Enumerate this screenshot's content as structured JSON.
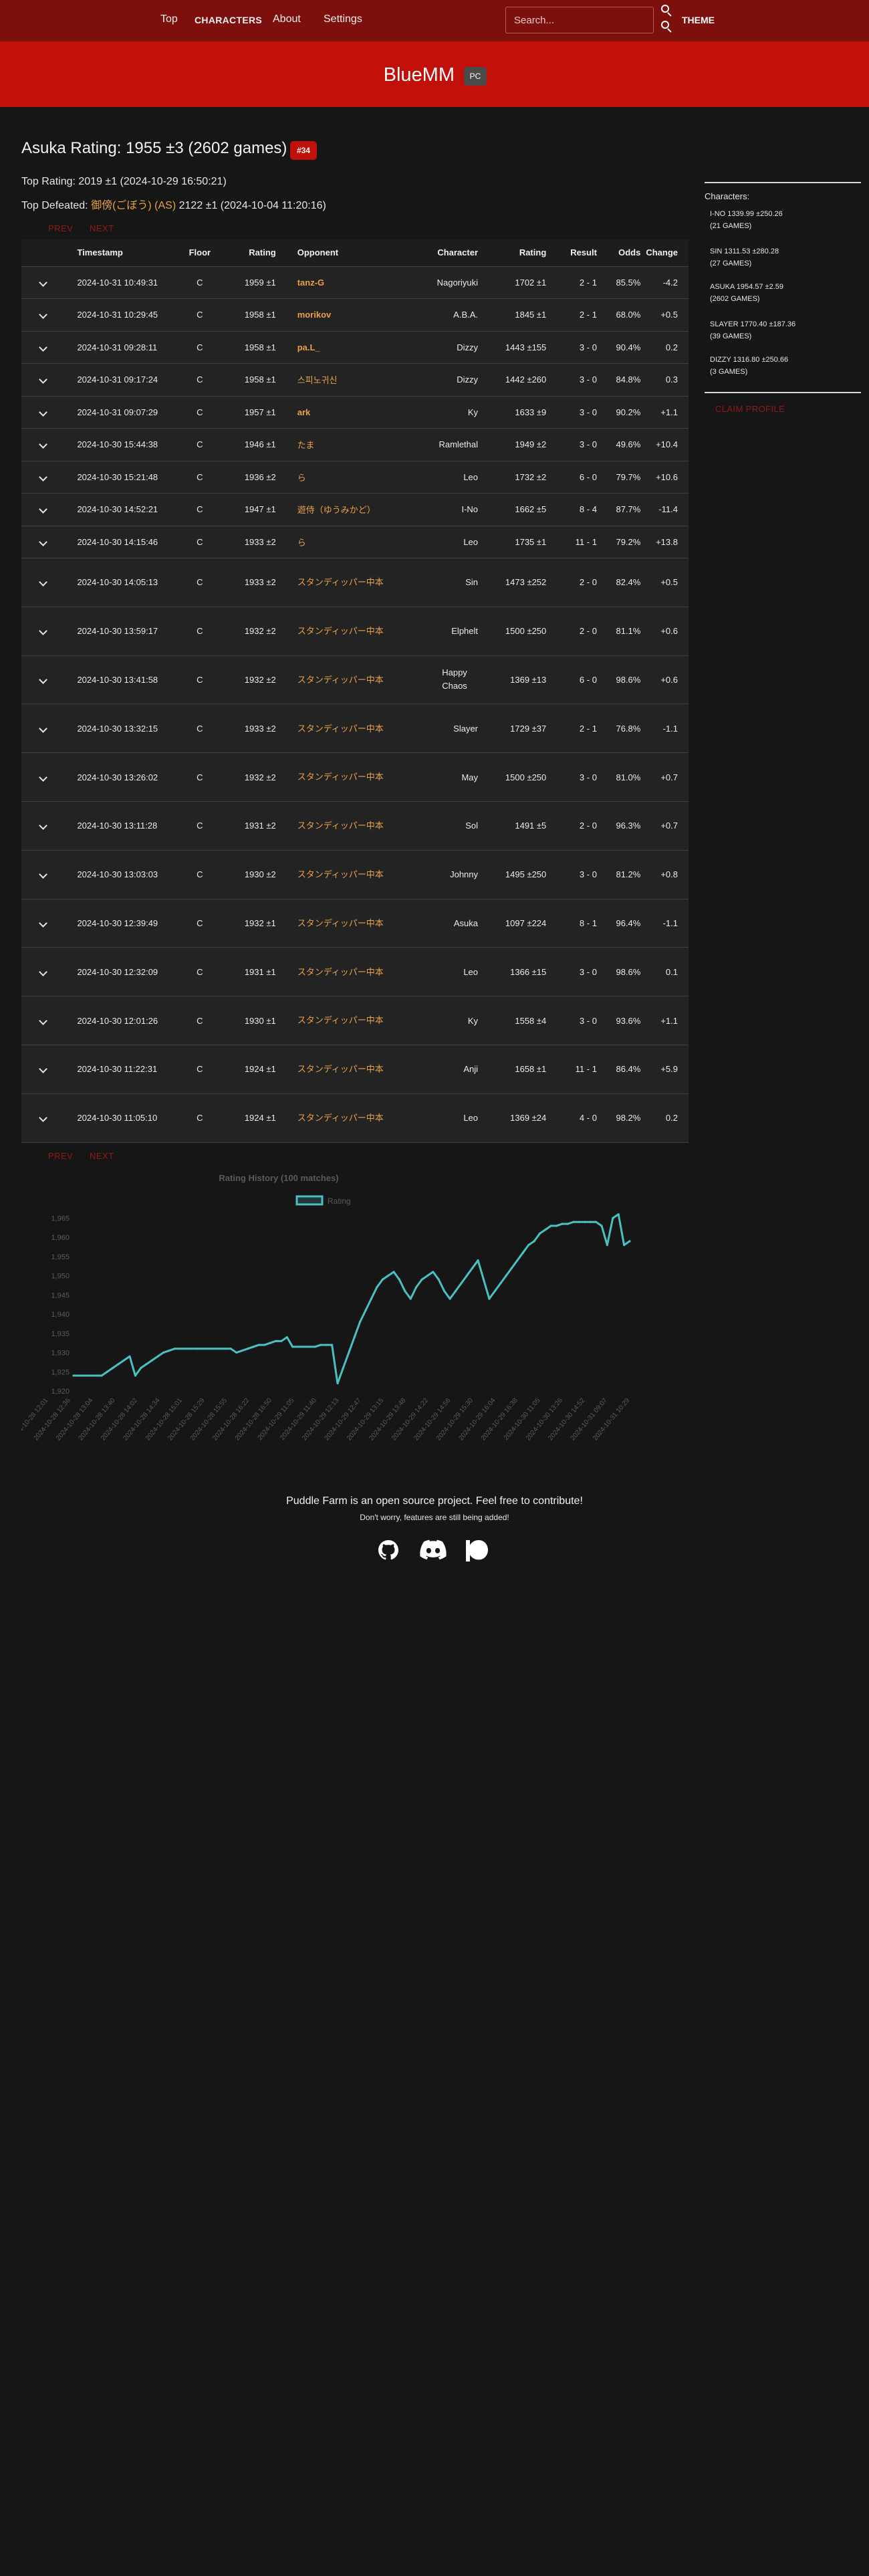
{
  "nav": {
    "top": "Top",
    "characters": "CHARACTERS",
    "about": "About",
    "settings": "Settings",
    "search_placeholder": "Search...",
    "theme": "THEME"
  },
  "banner": {
    "title": "BlueMM",
    "platform": "PC"
  },
  "header": {
    "rating_title": "Asuka Rating: 1955 ±3 (2602 games)",
    "rank": "#34",
    "top_rating": "Top Rating: 2019 ±1 (2024-10-29 16:50:21)",
    "top_defeated_prefix": "Top Defeated: ",
    "top_defeated_name": "御傍(ごぼう) (AS)",
    "top_defeated_suffix": " 2122 ±1 (2024-10-04 11:20:16)"
  },
  "pager": {
    "prev": "PREV",
    "next": "NEXT"
  },
  "table": {
    "headers": [
      "Timestamp",
      "Floor",
      "Rating",
      "Opponent",
      "Character",
      "Rating",
      "Result",
      "Odds",
      "Change"
    ],
    "rows": [
      {
        "timestamp": "2024-10-31 10:49:31",
        "floor": "C",
        "rating": "1959 ±1",
        "opponent": "tanz-G",
        "character": "Nagoriyuki",
        "opp_rating": "1702 ±1",
        "result": "2 - 1",
        "odds": "85.5%",
        "change": "-4.2"
      },
      {
        "timestamp": "2024-10-31 10:29:45",
        "floor": "C",
        "rating": "1958 ±1",
        "opponent": "morikov",
        "character": "A.B.A.",
        "opp_rating": "1845 ±1",
        "result": "2 - 1",
        "odds": "68.0%",
        "change": "+0.5"
      },
      {
        "timestamp": "2024-10-31 09:28:11",
        "floor": "C",
        "rating": "1958 ±1",
        "opponent": "pa.L_",
        "character": "Dizzy",
        "opp_rating": "1443 ±155",
        "result": "3 - 0",
        "odds": "90.4%",
        "change": "0.2"
      },
      {
        "timestamp": "2024-10-31 09:17:24",
        "floor": "C",
        "rating": "1958 ±1",
        "opponent": "스피노귀신",
        "character": "Dizzy",
        "opp_rating": "1442 ±260",
        "result": "3 - 0",
        "odds": "84.8%",
        "change": "0.3"
      },
      {
        "timestamp": "2024-10-31 09:07:29",
        "floor": "C",
        "rating": "1957 ±1",
        "opponent": "ark",
        "character": "Ky",
        "opp_rating": "1633 ±9",
        "result": "3 - 0",
        "odds": "90.2%",
        "change": "+1.1"
      },
      {
        "timestamp": "2024-10-30 15:44:38",
        "floor": "C",
        "rating": "1946 ±1",
        "opponent": "たま",
        "character": "Ramlethal",
        "opp_rating": "1949 ±2",
        "result": "3 - 0",
        "odds": "49.6%",
        "change": "+10.4"
      },
      {
        "timestamp": "2024-10-30 15:21:48",
        "floor": "C",
        "rating": "1936 ±2",
        "opponent": "ら",
        "character": "Leo",
        "opp_rating": "1732 ±2",
        "result": "6 - 0",
        "odds": "79.7%",
        "change": "+10.6"
      },
      {
        "timestamp": "2024-10-30 14:52:21",
        "floor": "C",
        "rating": "1947 ±1",
        "opponent": "遊侍（ゆうみかど）",
        "character": "I-No",
        "opp_rating": "1662 ±5",
        "result": "8 - 4",
        "odds": "87.7%",
        "change": "-11.4"
      },
      {
        "timestamp": "2024-10-30 14:15:46",
        "floor": "C",
        "rating": "1933 ±2",
        "opponent": "ら",
        "character": "Leo",
        "opp_rating": "1735 ±1",
        "result": "11 - 1",
        "odds": "79.2%",
        "change": "+13.8"
      },
      {
        "timestamp": "2024-10-30 14:05:13",
        "floor": "C",
        "rating": "1933 ±2",
        "opponent": "スタンディッパー中本",
        "character": "Sin",
        "opp_rating": "1473 ±252",
        "result": "2 - 0",
        "odds": "82.4%",
        "change": "+0.5"
      },
      {
        "timestamp": "2024-10-30 13:59:17",
        "floor": "C",
        "rating": "1932 ±2",
        "opponent": "スタンディッパー中本",
        "character": "Elphelt",
        "opp_rating": "1500 ±250",
        "result": "2 - 0",
        "odds": "81.1%",
        "change": "+0.6"
      },
      {
        "timestamp": "2024-10-30 13:41:58",
        "floor": "C",
        "rating": "1932 ±2",
        "opponent": "スタンディッパー中本",
        "character": "Happy Chaos",
        "opp_rating": "1369 ±13",
        "result": "6 - 0",
        "odds": "98.6%",
        "change": "+0.6"
      },
      {
        "timestamp": "2024-10-30 13:32:15",
        "floor": "C",
        "rating": "1933 ±2",
        "opponent": "スタンディッパー中本",
        "character": "Slayer",
        "opp_rating": "1729 ±37",
        "result": "2 - 1",
        "odds": "76.8%",
        "change": "-1.1"
      },
      {
        "timestamp": "2024-10-30 13:26:02",
        "floor": "C",
        "rating": "1932 ±2",
        "opponent": "スタンディッパー中本",
        "character": "May",
        "opp_rating": "1500 ±250",
        "result": "3 - 0",
        "odds": "81.0%",
        "change": "+0.7"
      },
      {
        "timestamp": "2024-10-30 13:11:28",
        "floor": "C",
        "rating": "1931 ±2",
        "opponent": "スタンディッパー中本",
        "character": "Sol",
        "opp_rating": "1491 ±5",
        "result": "2 - 0",
        "odds": "96.3%",
        "change": "+0.7"
      },
      {
        "timestamp": "2024-10-30 13:03:03",
        "floor": "C",
        "rating": "1930 ±2",
        "opponent": "スタンディッパー中本",
        "character": "Johnny",
        "opp_rating": "1495 ±250",
        "result": "3 - 0",
        "odds": "81.2%",
        "change": "+0.8"
      },
      {
        "timestamp": "2024-10-30 12:39:49",
        "floor": "C",
        "rating": "1932 ±1",
        "opponent": "スタンディッパー中本",
        "character": "Asuka",
        "opp_rating": "1097 ±224",
        "result": "8 - 1",
        "odds": "96.4%",
        "change": "-1.1"
      },
      {
        "timestamp": "2024-10-30 12:32:09",
        "floor": "C",
        "rating": "1931 ±1",
        "opponent": "スタンディッパー中本",
        "character": "Leo",
        "opp_rating": "1366 ±15",
        "result": "3 - 0",
        "odds": "98.6%",
        "change": "0.1"
      },
      {
        "timestamp": "2024-10-30 12:01:26",
        "floor": "C",
        "rating": "1930 ±1",
        "opponent": "スタンディッパー中本",
        "character": "Ky",
        "opp_rating": "1558 ±4",
        "result": "3 - 0",
        "odds": "93.6%",
        "change": "+1.1"
      },
      {
        "timestamp": "2024-10-30 11:22:31",
        "floor": "C",
        "rating": "1924 ±1",
        "opponent": "スタンディッパー中本",
        "character": "Anji",
        "opp_rating": "1658 ±1",
        "result": "11 - 1",
        "odds": "86.4%",
        "change": "+5.9"
      },
      {
        "timestamp": "2024-10-30 11:05:10",
        "floor": "C",
        "rating": "1924 ±1",
        "opponent": "スタンディッパー中本",
        "character": "Leo",
        "opp_rating": "1369 ±24",
        "result": "4 - 0",
        "odds": "98.2%",
        "change": "0.2"
      }
    ]
  },
  "sidebar": {
    "label": "Characters:",
    "items": [
      {
        "line1": "I-NO 1339.99 ±250.26",
        "line2": "(21 GAMES)"
      },
      {
        "line1": "SIN 1311.53 ±280.28",
        "line2": "(27 GAMES)"
      },
      {
        "line1": "ASUKA 1954.57 ±2.59",
        "line2": "(2602 GAMES)"
      },
      {
        "line1": "SLAYER 1770.40 ±187.36",
        "line2": "(39 GAMES)"
      },
      {
        "line1": "DIZZY 1316.80 ±250.66",
        "line2": "(3 GAMES)"
      }
    ],
    "claim": "CLAIM PROFILE"
  },
  "colors": {
    "nav_bg": "#7d100c",
    "banner_bg": "#c1100a",
    "link": "#e8a04b",
    "chart_line": "#4bc0c0"
  },
  "chart_data": {
    "type": "line",
    "title": "Rating History (100 matches)",
    "legend": [
      "Rating"
    ],
    "legend_position": "top",
    "ylim": [
      1920,
      1967
    ],
    "y_ticks": [
      "1,920",
      "1,925",
      "1,930",
      "1,935",
      "1,940",
      "1,945",
      "1,950",
      "1,955",
      "1,960",
      "1,965"
    ],
    "grid": false,
    "x_ticks": [
      "2024-10-28 12:01",
      "2024-10-28 12:36",
      "2024-10-28 13:04",
      "2024-10-28 13:40",
      "2024-10-28 14:02",
      "2024-10-28 14:34",
      "2024-10-28 15:01",
      "2024-10-28 15:29",
      "2024-10-28 15:55",
      "2024-10-28 16:22",
      "2024-10-28 16:50",
      "2024-10-29 11:05",
      "2024-10-29 11:40",
      "2024-10-29 12:13",
      "2024-10-29 12:47",
      "2024-10-29 13:15",
      "2024-10-29 13:48",
      "2024-10-29 14:22",
      "2024-10-29 14:56",
      "2024-10-29 15:30",
      "2024-10-29 16:04",
      "2024-10-29 16:38",
      "2024-10-30 11:05",
      "2024-10-30 13:26",
      "2024-10-30 14:52",
      "2024-10-31 09:07",
      "2024-10-31 10:29"
    ],
    "series": [
      {
        "name": "Rating",
        "values": [
          1924,
          1924,
          1924,
          1924,
          1924,
          1924,
          1925,
          1926,
          1927,
          1928,
          1929,
          1924,
          1926,
          1927,
          1928,
          1929,
          1930,
          1930.5,
          1931,
          1931,
          1931,
          1931,
          1931,
          1931,
          1931,
          1931,
          1931,
          1931,
          1931,
          1930,
          1930.5,
          1931,
          1931.5,
          1932,
          1932,
          1932.5,
          1933,
          1933,
          1934,
          1931.5,
          1931.5,
          1931.5,
          1931.5,
          1931.5,
          1932,
          1932,
          1932,
          1922,
          1926,
          1930,
          1934,
          1938,
          1941,
          1944,
          1947,
          1949,
          1950,
          1951,
          1949,
          1946,
          1944,
          1947,
          1949,
          1950,
          1951,
          1949,
          1946,
          1944,
          1946,
          1948,
          1950,
          1952,
          1954,
          1949,
          1944,
          1946,
          1948,
          1950,
          1952,
          1954,
          1956,
          1958,
          1959,
          1961,
          1962,
          1963,
          1963,
          1963.5,
          1963.5,
          1964,
          1964,
          1964,
          1964,
          1964,
          1963,
          1958,
          1965,
          1966,
          1958,
          1959
        ]
      }
    ]
  },
  "footer": {
    "main": "Puddle Farm is an open source project. Feel free to contribute!",
    "sub": "Don't worry, features are still being added!"
  }
}
